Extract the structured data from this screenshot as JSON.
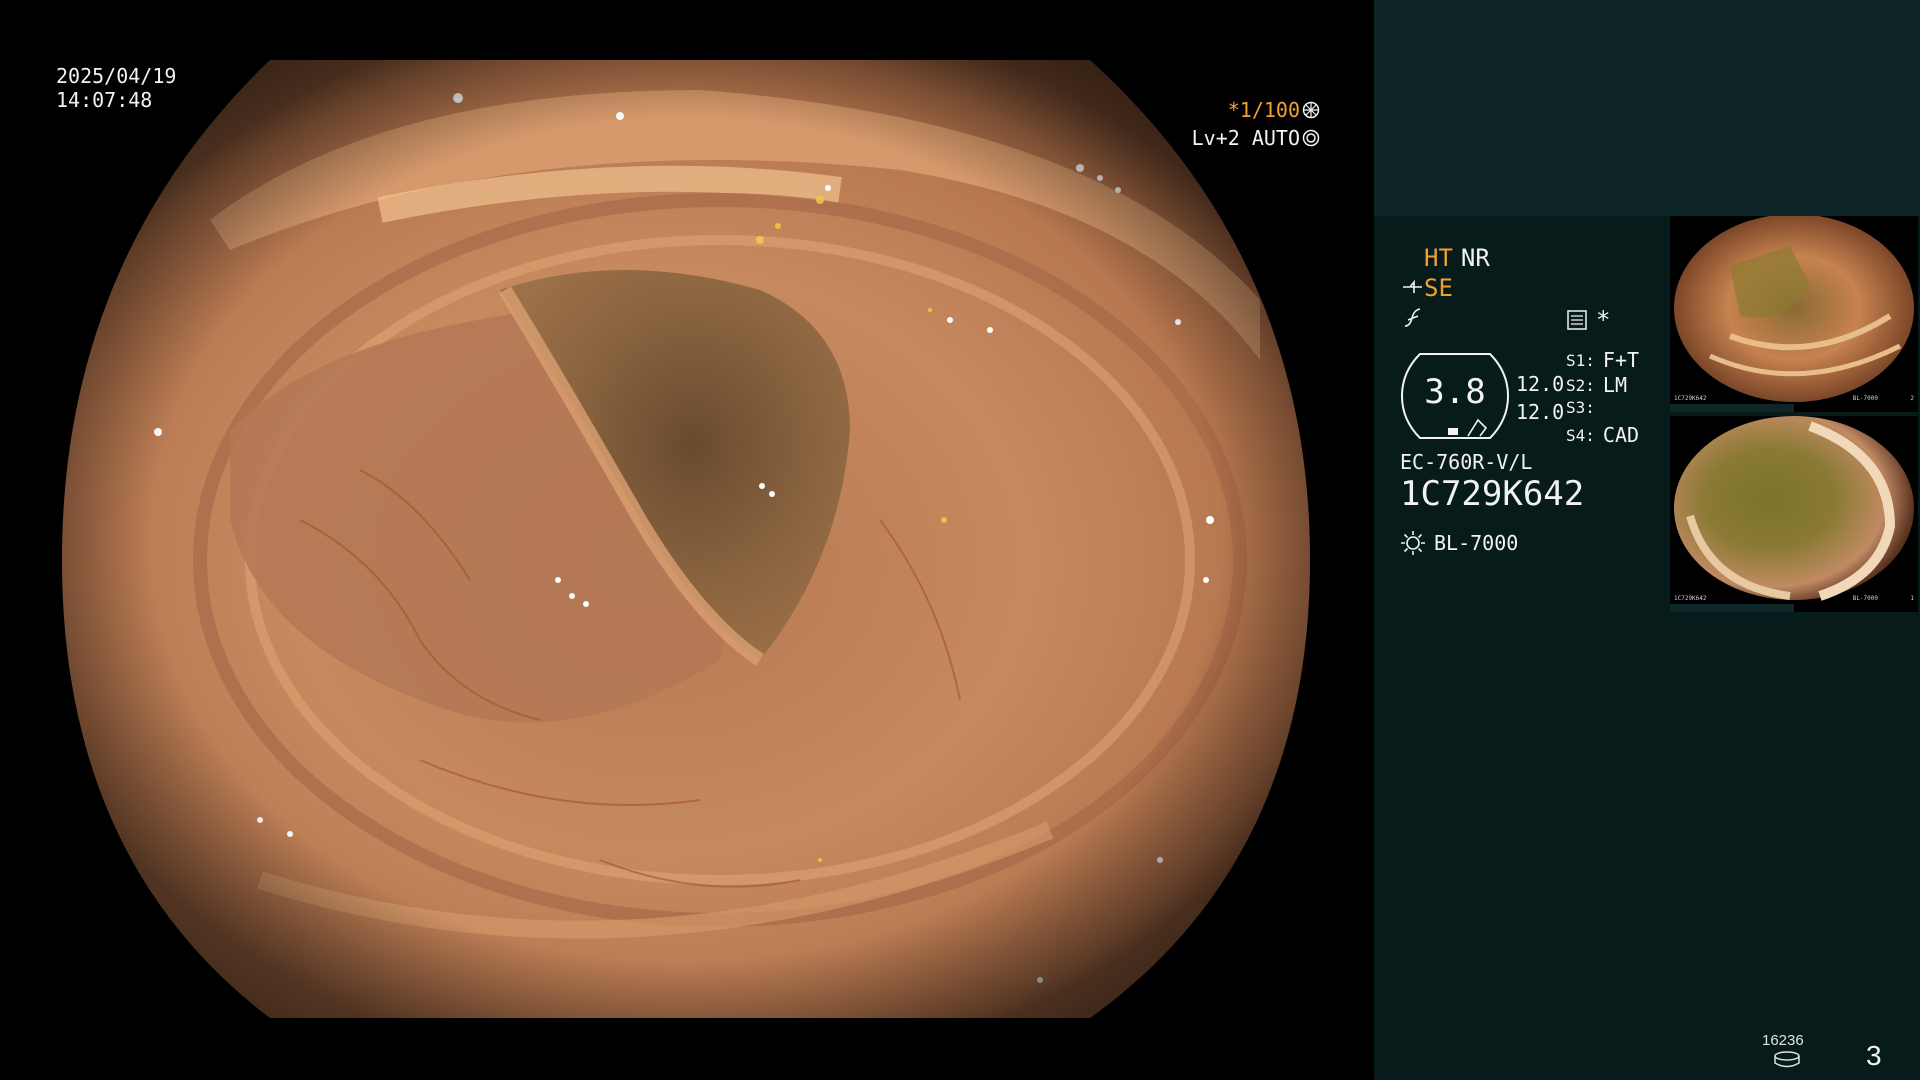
{
  "overlay": {
    "date": "2025/04/19",
    "time": "14:07:48",
    "shutter": "*1/100",
    "shutter_icon": "shutter-wheel-icon",
    "level": "Lv+2 AUTO",
    "level_icon": "auto-iris-icon"
  },
  "panel": {
    "ht_label": "HT",
    "nr_label": "NR",
    "se_label": "SE",
    "se_icon": "structure-enhancement-icon",
    "f_icon": "contrast-curve-icon",
    "mode_icon": "image-mode-icon",
    "mode_star": "*",
    "zoom_value": "3.8",
    "param1": "12.0",
    "param2": "12.0",
    "switches": [
      {
        "id": "S1:",
        "value": "F+T"
      },
      {
        "id": "S2:",
        "value": "LM"
      },
      {
        "id": "S3:",
        "value": ""
      },
      {
        "id": "S4:",
        "value": "CAD"
      }
    ],
    "scope_model": "EC-760R-V/L",
    "scope_serial": "1C729K642",
    "light_source": "BL-7000",
    "light_icon": "light-source-icon",
    "image_count": "16236",
    "storage_icon": "storage-disk-icon",
    "page_number": "3"
  },
  "thumbnails": [
    {
      "label": "1C729K642",
      "index": "2",
      "light": "BL-7000"
    },
    {
      "label": "1C729K642",
      "index": "1",
      "light": "BL-7000"
    }
  ],
  "colors": {
    "accent_amber": "#f0a030",
    "panel_top": "#0e2628",
    "panel_body": "#071b1b"
  }
}
